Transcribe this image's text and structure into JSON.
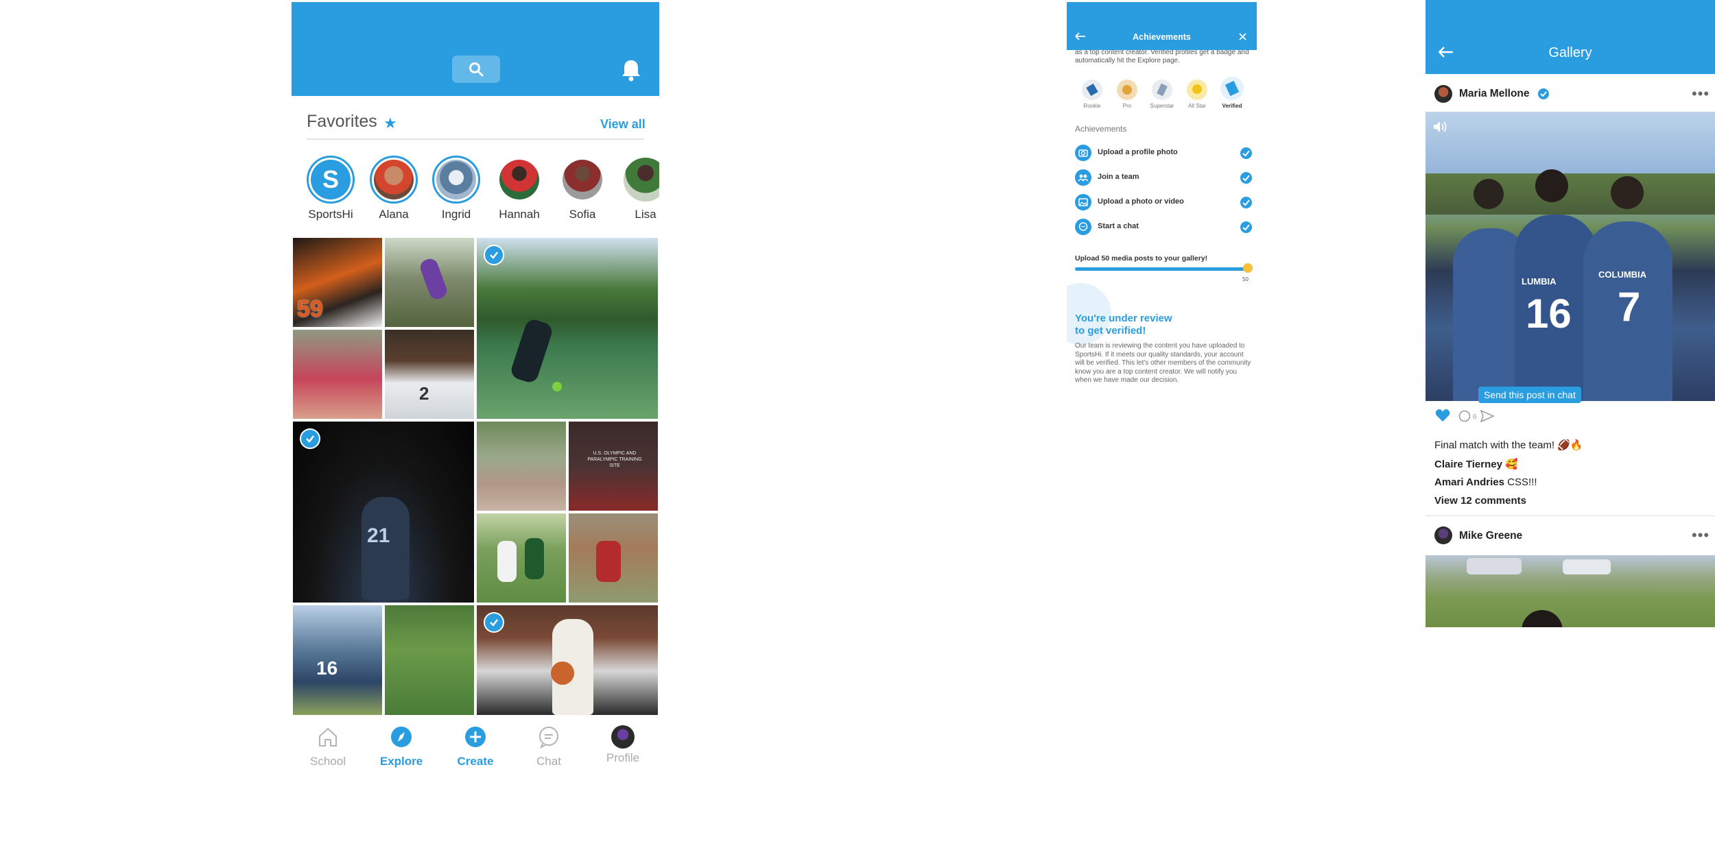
{
  "explore": {
    "favorites_title": "Favorites",
    "view_all": "View all",
    "stories": [
      {
        "name": "SportsHi",
        "logo": "S"
      },
      {
        "name": "Alana"
      },
      {
        "name": "Ingrid"
      },
      {
        "name": "Hannah"
      },
      {
        "name": "Sofia"
      },
      {
        "name": "Lisa"
      }
    ],
    "tabs": [
      {
        "label": "School",
        "icon": "home-icon",
        "active": false
      },
      {
        "label": "Explore",
        "icon": "compass-icon",
        "active": true
      },
      {
        "label": "Create",
        "icon": "plus-icon",
        "active": true
      },
      {
        "label": "Chat",
        "icon": "chat-bubble-icon",
        "active": false
      },
      {
        "label": "Profile",
        "icon": "avatar-icon",
        "active": false
      }
    ],
    "photo_1_jersey": "59",
    "photo_2_jersey": "2",
    "photo_3_jersey": "21",
    "photo_4_text": "U.S. OLYMPIC AND PARALYMPIC TRAINING SITE",
    "photo_5_jersey": "16"
  },
  "achievements": {
    "title": "Achievements",
    "intro": "as a top content creator. Verified profiles get a badge and automatically hit the Explore page.",
    "badges": [
      "Rookie",
      "Pro",
      "Superstar",
      "All Star",
      "Verified"
    ],
    "section_label": "Achievements",
    "items": [
      "Upload a profile photo",
      "Join a team",
      "Upload a photo or video",
      "Start a chat"
    ],
    "progress_label": "Upload 50 media posts to your gallery!",
    "progress_count": "50",
    "progress_fraction": 1.0,
    "review_title_1": "You're under review",
    "review_title_2": "to get verified!",
    "review_body": "Our team is reviewing the content you have uploaded to SportsHi. If it meets our quality standards, your account will be verified. This let's other members of the community know you are a top content creator. We will notify you when we have made our decision."
  },
  "gallery": {
    "title": "Gallery",
    "post1": {
      "author": "Maria Mellone",
      "verified": true,
      "tooltip": "Send this post in chat",
      "comment_count": "6",
      "jersey_left": "16",
      "jersey_right": "7",
      "jersey_text_left": "LUMBIA",
      "jersey_text_right": "COLUMBIA",
      "caption": "Final match with the team! 🏈🔥",
      "comments": [
        {
          "user": "Claire Tierney",
          "text": "🥰"
        },
        {
          "user": "Amari Andries",
          "text": "CSS!!!"
        }
      ],
      "view_comments": "View 12 comments"
    },
    "post2": {
      "author": "Mike Greene"
    }
  }
}
